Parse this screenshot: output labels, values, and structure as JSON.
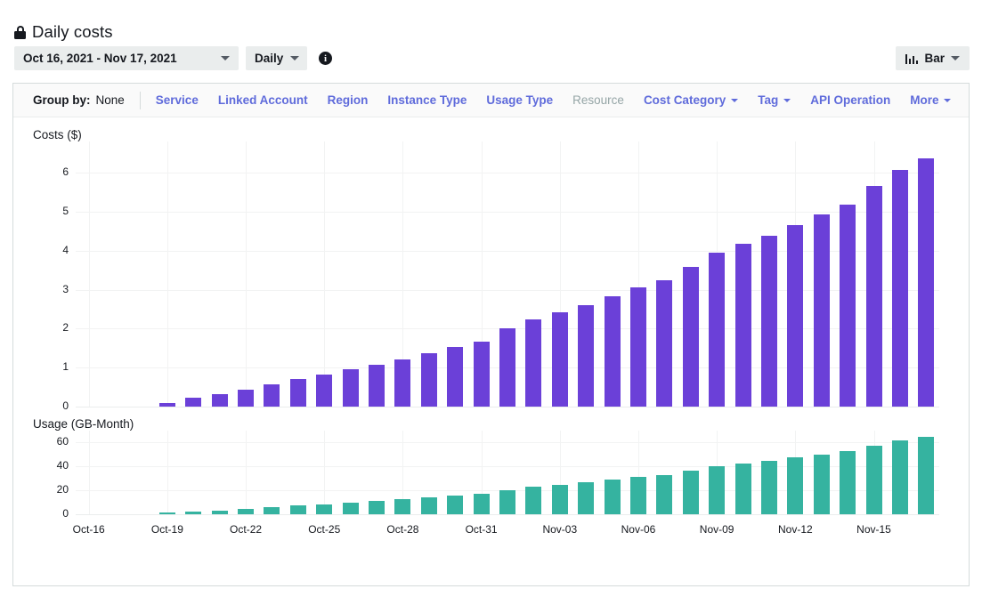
{
  "header": {
    "title": "Daily costs",
    "lock_icon": "lock-icon",
    "date_range": "Oct 16, 2021 - Nov 17, 2021",
    "granularity": "Daily",
    "info_icon": "info-icon",
    "info_glyph": "i",
    "chart_type": "Bar",
    "chart_type_icon": "bar-chart-icon"
  },
  "groupby": {
    "label": "Group by:",
    "value": "None",
    "options": [
      {
        "label": "Service",
        "disabled": false,
        "caret": false
      },
      {
        "label": "Linked Account",
        "disabled": false,
        "caret": false
      },
      {
        "label": "Region",
        "disabled": false,
        "caret": false
      },
      {
        "label": "Instance Type",
        "disabled": false,
        "caret": false
      },
      {
        "label": "Usage Type",
        "disabled": false,
        "caret": false
      },
      {
        "label": "Resource",
        "disabled": true,
        "caret": false
      },
      {
        "label": "Cost Category",
        "disabled": false,
        "caret": true
      },
      {
        "label": "Tag",
        "disabled": false,
        "caret": true
      },
      {
        "label": "API Operation",
        "disabled": false,
        "caret": false
      }
    ],
    "more": "More"
  },
  "colors": {
    "cost_bar": "#6b40d8",
    "usage_bar": "#35b3a0",
    "link": "#5f6bdb",
    "disabled": "#95a5a6",
    "grid": "#f2f3f3"
  },
  "chart_data": [
    {
      "type": "bar",
      "title": "Costs ($)",
      "ylabel": "Costs ($)",
      "xlabel": "",
      "ylim": [
        0,
        6.8
      ],
      "yticks": [
        0,
        1,
        2,
        3,
        4,
        5,
        6
      ],
      "grid": true,
      "legend": "none",
      "color": "#6b40d8",
      "categories": [
        "Oct-16",
        "Oct-17",
        "Oct-18",
        "Oct-19",
        "Oct-20",
        "Oct-21",
        "Oct-22",
        "Oct-23",
        "Oct-24",
        "Oct-25",
        "Oct-26",
        "Oct-27",
        "Oct-28",
        "Oct-29",
        "Oct-30",
        "Oct-31",
        "Nov-01",
        "Nov-02",
        "Nov-03",
        "Nov-04",
        "Nov-05",
        "Nov-06",
        "Nov-07",
        "Nov-08",
        "Nov-09",
        "Nov-10",
        "Nov-11",
        "Nov-12",
        "Nov-13",
        "Nov-14",
        "Nov-15",
        "Nov-16",
        "Nov-17"
      ],
      "xtick_labels": [
        "Oct-16",
        "Oct-19",
        "Oct-22",
        "Oct-25",
        "Oct-28",
        "Oct-31",
        "Nov-03",
        "Nov-06",
        "Nov-09",
        "Nov-12",
        "Nov-15"
      ],
      "xtick_indices": [
        0,
        3,
        6,
        9,
        12,
        15,
        18,
        21,
        24,
        27,
        30
      ],
      "values": [
        0,
        0,
        0,
        0.1,
        0.22,
        0.31,
        0.44,
        0.57,
        0.7,
        0.82,
        0.95,
        1.08,
        1.22,
        1.36,
        1.52,
        1.67,
        2.0,
        2.24,
        2.43,
        2.61,
        2.84,
        3.05,
        3.23,
        3.59,
        3.94,
        4.17,
        4.39,
        4.65,
        4.92,
        5.19,
        5.65,
        6.08,
        6.37
      ]
    },
    {
      "type": "bar",
      "title": "Usage (GB-Month)",
      "ylabel": "Usage (GB-Month)",
      "xlabel": "",
      "ylim": [
        0,
        70
      ],
      "yticks": [
        0,
        20,
        40,
        60
      ],
      "grid": true,
      "legend": "none",
      "color": "#35b3a0",
      "categories": [
        "Oct-16",
        "Oct-17",
        "Oct-18",
        "Oct-19",
        "Oct-20",
        "Oct-21",
        "Oct-22",
        "Oct-23",
        "Oct-24",
        "Oct-25",
        "Oct-26",
        "Oct-27",
        "Oct-28",
        "Oct-29",
        "Oct-30",
        "Oct-31",
        "Nov-01",
        "Nov-02",
        "Nov-03",
        "Nov-04",
        "Nov-05",
        "Nov-06",
        "Nov-07",
        "Nov-08",
        "Nov-09",
        "Nov-10",
        "Nov-11",
        "Nov-12",
        "Nov-13",
        "Nov-14",
        "Nov-15",
        "Nov-16",
        "Nov-17"
      ],
      "xtick_labels": [
        "Oct-16",
        "Oct-19",
        "Oct-22",
        "Oct-25",
        "Oct-28",
        "Oct-31",
        "Nov-03",
        "Nov-06",
        "Nov-09",
        "Nov-12",
        "Nov-15"
      ],
      "xtick_indices": [
        0,
        3,
        6,
        9,
        12,
        15,
        18,
        21,
        24,
        27,
        30
      ],
      "values": [
        0,
        0,
        0,
        1.0,
        2.2,
        3.2,
        4.5,
        5.8,
        7.1,
        8.4,
        9.7,
        11.0,
        12.4,
        13.9,
        15.5,
        17.0,
        20.4,
        22.8,
        24.8,
        26.6,
        29.0,
        31.1,
        33.0,
        36.6,
        40.2,
        42.5,
        44.8,
        47.4,
        50.2,
        52.9,
        57.6,
        62.0,
        65.0
      ]
    }
  ]
}
